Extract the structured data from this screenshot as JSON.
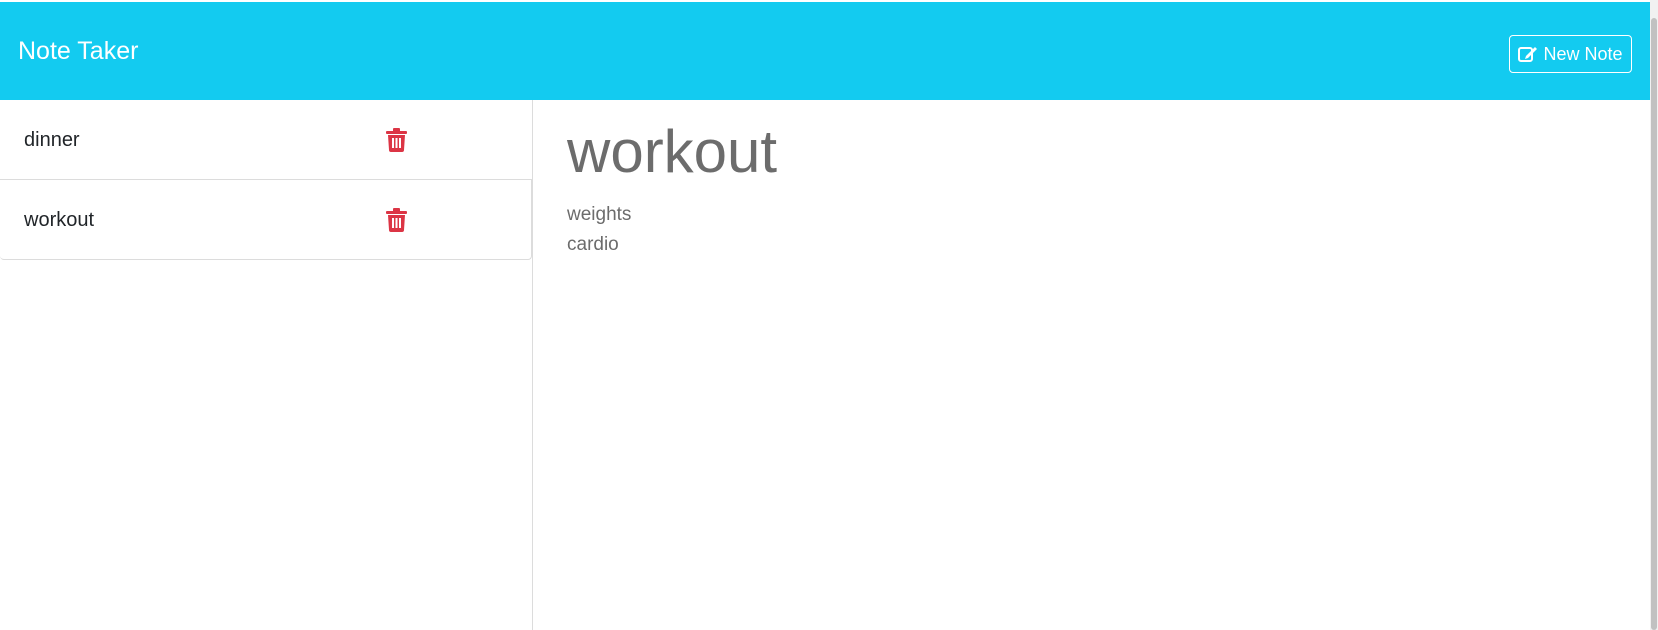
{
  "navbar": {
    "brand": "Note Taker",
    "new_note_label": "New Note",
    "background": "#13cbf0"
  },
  "sidebar": {
    "notes": [
      {
        "title": "dinner",
        "icon": "trash-icon"
      },
      {
        "title": "workout",
        "icon": "trash-icon"
      }
    ],
    "delete_color": "#dc3545"
  },
  "main": {
    "title": "workout",
    "body_lines": [
      "weights",
      "cardio"
    ]
  }
}
